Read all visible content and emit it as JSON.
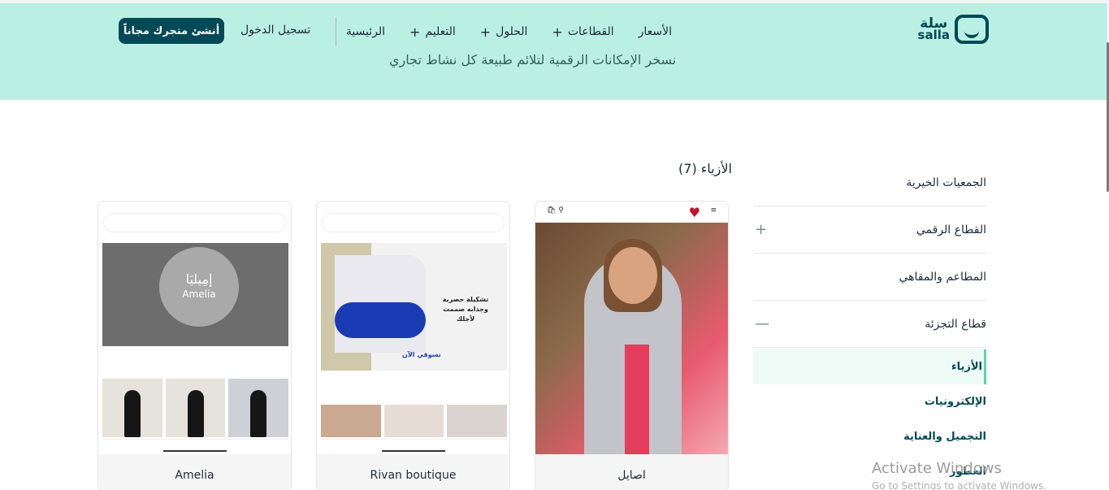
{
  "header": {
    "logo": {
      "arabic": "سلة",
      "latin": "salla"
    },
    "nav": [
      {
        "label": "الرئيسية",
        "has_plus": false
      },
      {
        "label": "التعليم",
        "has_plus": true
      },
      {
        "label": "الحلول",
        "has_plus": true
      },
      {
        "label": "القطاعات",
        "has_plus": true
      },
      {
        "label": "الأسعار",
        "has_plus": false
      }
    ],
    "plus_symbol": "+",
    "login_label": "تسجيل الدخول",
    "cta_label": "أنشئ متجرك مجاناً",
    "subtitle": "نسخر الإمكانات الرقمية لتلائم طبيعة كل نشاط تجاري"
  },
  "colors": {
    "hero_bg": "#baf0e3",
    "brand": "#004956",
    "active_indicator": "#5bd3b3"
  },
  "sidebar": {
    "categories": [
      {
        "label": "الجمعيات الخيرية",
        "sign": ""
      },
      {
        "label": "القطاع الرقمي",
        "sign": "+"
      },
      {
        "label": "المطاعم والمقاهي",
        "sign": ""
      },
      {
        "label": "قطاع التجزئة",
        "sign": "—"
      }
    ],
    "subcategories": [
      {
        "label": "الأزياء",
        "active": true
      },
      {
        "label": "الإلكترونيات",
        "active": false
      },
      {
        "label": "التجميل والعناية",
        "active": false
      },
      {
        "label": "العطور",
        "active": false
      }
    ]
  },
  "products": {
    "section_title": "الأزياء (7)",
    "items": [
      {
        "name": "اصايل"
      },
      {
        "name": "Rivan boutique"
      },
      {
        "name": "Amelia"
      }
    ],
    "amelia_logo": {
      "arabic": "إمِيليَا",
      "latin": "Amelia"
    },
    "rivan_banner_text": "تشكيلة حصرية وجذابه صممت لأجلك",
    "rivan_banner_cta": "تسوقي الآن"
  },
  "watermark": {
    "title": "Activate Windows",
    "subtitle": "Go to Settings to activate Windows."
  }
}
